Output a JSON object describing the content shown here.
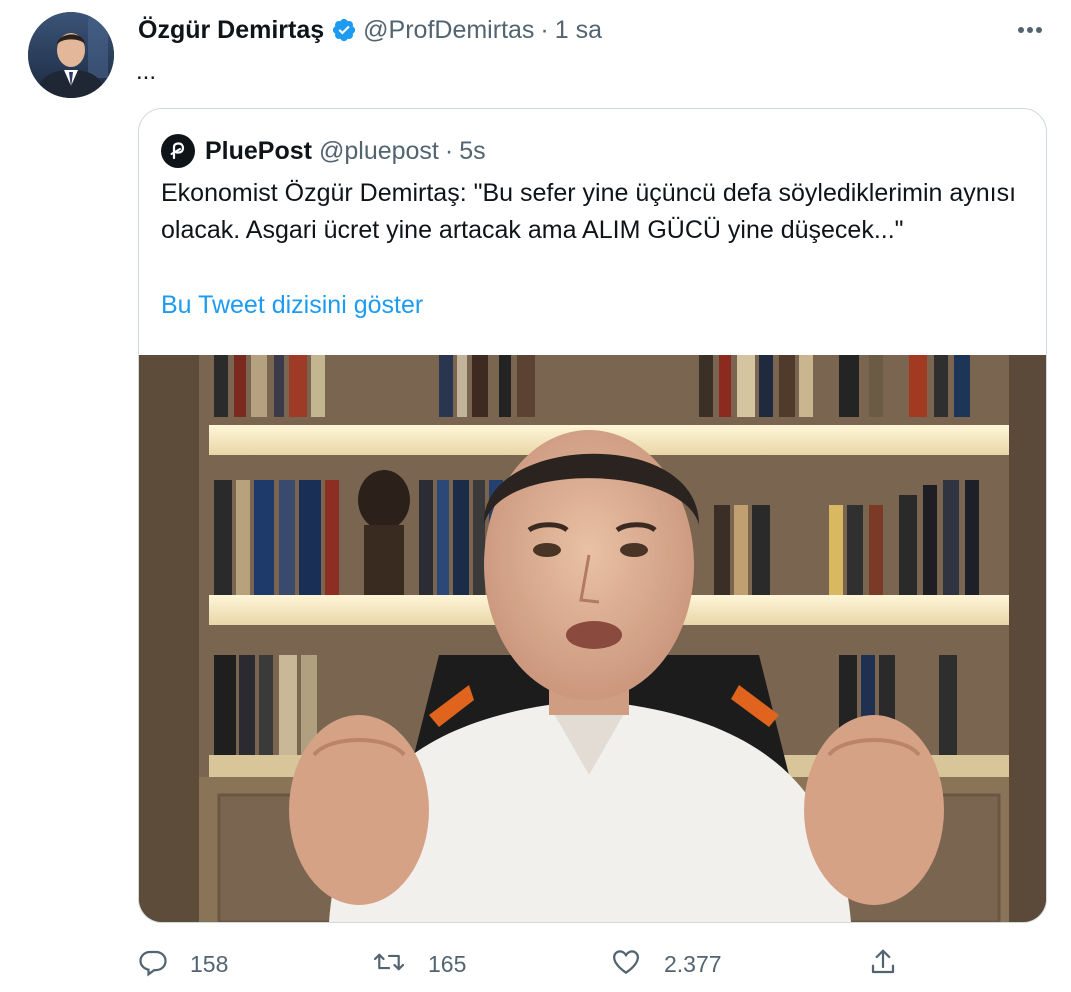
{
  "tweet": {
    "author_name": "Özgür Demirtaş",
    "author_handle": "@ProfDemirtas",
    "dot": "·",
    "time": "1 sa",
    "text": "...",
    "avatar_icon": "person-avatar",
    "verified_icon": "verified-badge-icon",
    "more_icon": "more-horizontal-icon"
  },
  "quoted": {
    "author_name": "PluePost",
    "author_handle": "@pluepost",
    "dot": "·",
    "time": "5s",
    "text": "Ekonomist Özgür Demirtaş: \"Bu sefer yine üçüncü defa söylediklerimin aynısı olacak. Asgari ücret yine artacak ama ALIM GÜCÜ yine düşecek...\"",
    "show_thread": "Bu Tweet dizisini göster",
    "logo_icon": "pluepost-logo"
  },
  "actions": {
    "reply_count": "158",
    "retweet_count": "165",
    "like_count": "2.377",
    "reply_icon": "reply-icon",
    "retweet_icon": "retweet-icon",
    "like_icon": "heart-icon",
    "share_icon": "share-icon"
  },
  "colors": {
    "accent": "#1d9bf0",
    "secondary_text": "#536471",
    "border": "#cfd9de"
  }
}
